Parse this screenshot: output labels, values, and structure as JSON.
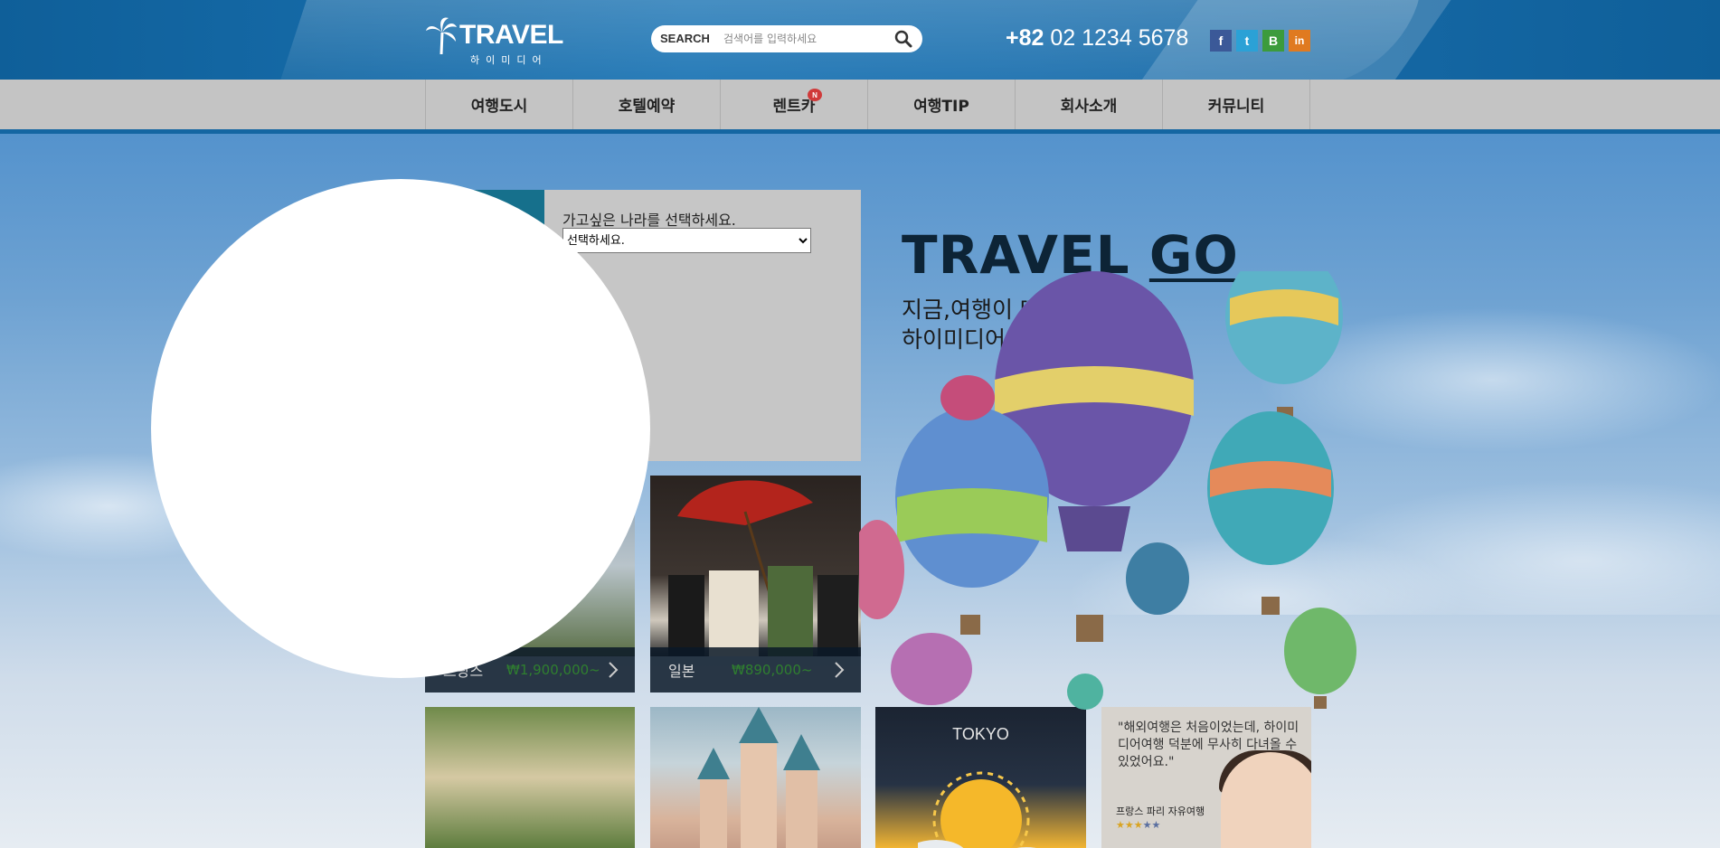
{
  "header": {
    "logo_title": "TRAVEL",
    "logo_subtitle": "하이미디어",
    "search_label": "SEARCH",
    "search_placeholder": "검색어를 입력하세요",
    "phone_prefix": "+82",
    "phone_number": "02 1234 5678",
    "social": [
      {
        "icon": "facebook-icon",
        "glyph": "f",
        "color": "#3b5998"
      },
      {
        "icon": "twitter-icon",
        "glyph": "t",
        "color": "#2ba1d6"
      },
      {
        "icon": "blog-icon",
        "glyph": "B",
        "color": "#3c9b3c"
      },
      {
        "icon": "linkedin-icon",
        "glyph": "in",
        "color": "#e07a20"
      }
    ]
  },
  "nav": {
    "items": [
      {
        "label": "여행도시"
      },
      {
        "label": "호텔예약"
      },
      {
        "label": "렌트카",
        "badge": "N"
      },
      {
        "label": "여행TIP"
      },
      {
        "label": "회사소개"
      },
      {
        "label": "커뮤니티"
      }
    ]
  },
  "search_panel": {
    "label": "가고싶은 나라를 선택하세요.",
    "selected": "선택하세요."
  },
  "hero": {
    "title_part1": "TRAVEL",
    "title_part2": "GO",
    "line1": "지금,여행이 떠나고 싶다면?",
    "line2": "하이미디어와 여행을 떠나자!"
  },
  "tiles": {
    "france": {
      "country": "프랑스",
      "price": "₩1,900,000~"
    },
    "japan": {
      "country": "일본",
      "price": "₩890,000~"
    },
    "weather": {
      "city": "TOKYO"
    },
    "review": {
      "quote": "\"해외여행은 처음이었는데, 하이미디어여행 덕분에 무사히 다녀올 수 있었어요.\"",
      "name": "프랑스 파리 자유여행",
      "stars_on": "★★★",
      "stars_off": "★★"
    }
  },
  "colors": {
    "header_blue": "#1a6fae",
    "nav_gray": "#c4c4c4",
    "nav_border": "#1466a2",
    "price_green": "#2f7f2f",
    "teal": "#16708c"
  }
}
